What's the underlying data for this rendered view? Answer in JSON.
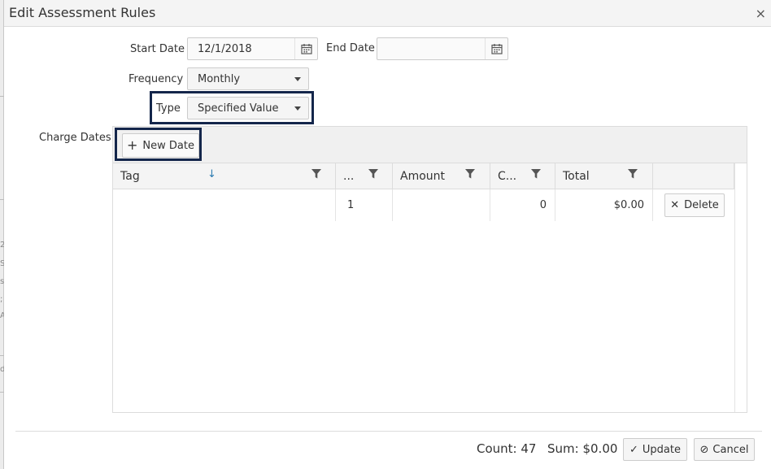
{
  "window": {
    "title": "Edit Assessment Rules",
    "close_glyph": "×"
  },
  "background": {
    "glyphs": [
      "2",
      "S",
      "s",
      ";",
      "A",
      "d"
    ]
  },
  "form": {
    "start_date_label": "Start Date",
    "start_date_value": "12/1/2018",
    "end_date_label": "End Date",
    "end_date_value": "",
    "frequency_label": "Frequency",
    "frequency_value": "Monthly",
    "type_label": "Type",
    "type_value": "Specified Value",
    "charge_dates_label": "Charge Dates"
  },
  "grid": {
    "toolbar": {
      "new_date_label": "New Date",
      "new_date_glyph": "+"
    },
    "columns": [
      {
        "label": "Tag",
        "sorted": "asc"
      },
      {
        "label": "..."
      },
      {
        "label": "Amount"
      },
      {
        "label": "C..."
      },
      {
        "label": "Total"
      },
      {
        "label": ""
      }
    ],
    "sort_glyph": "↓",
    "rows": [
      {
        "tag": "",
        "num": "1",
        "amount": "",
        "count": "0",
        "total": "$0.00",
        "delete_label": "Delete",
        "delete_glyph": "✕"
      }
    ]
  },
  "footer": {
    "count_text": "Count: 47",
    "sum_text": "Sum: $0.00",
    "update_label": "Update",
    "update_glyph": "✓",
    "cancel_label": "Cancel",
    "cancel_glyph": "⊘"
  },
  "colors": {
    "focus_border": "#14264b",
    "sort_arrow": "#2a7ab0"
  }
}
